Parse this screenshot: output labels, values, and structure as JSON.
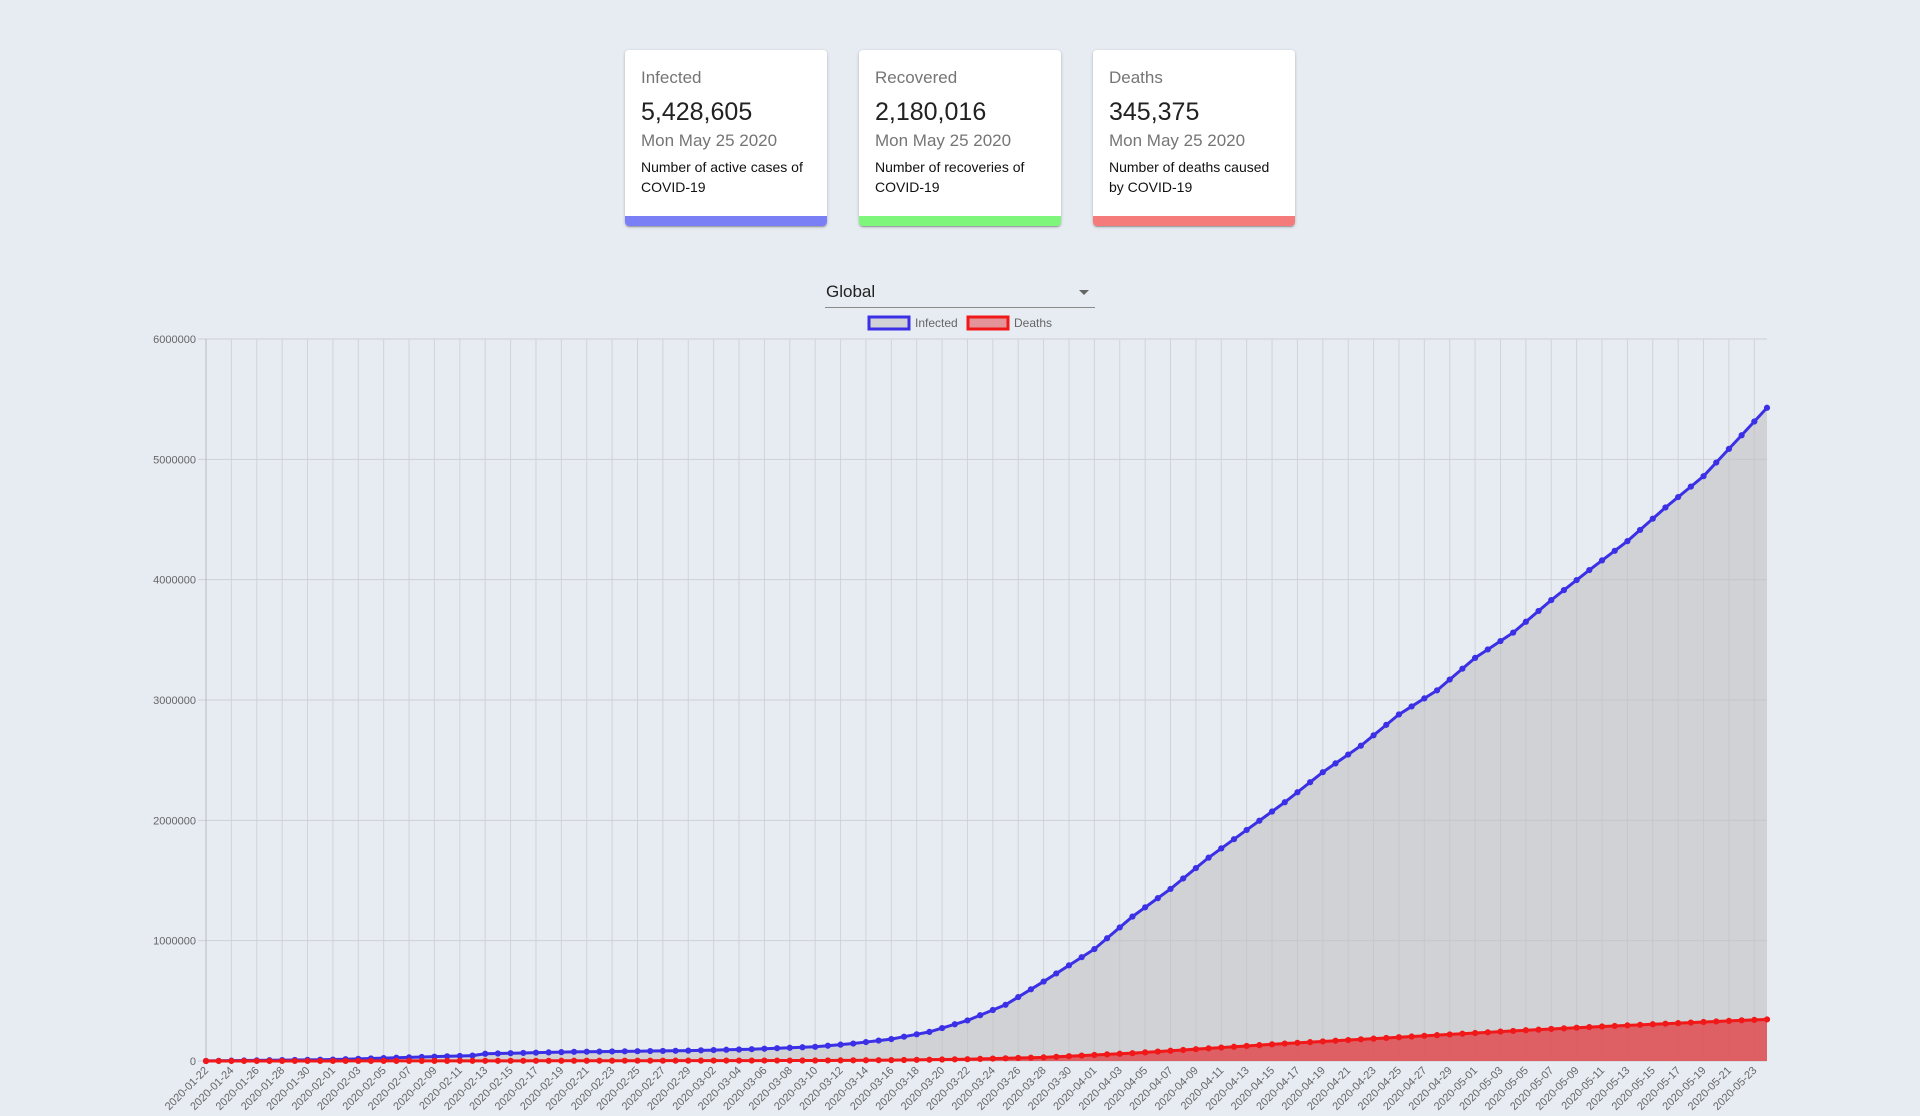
{
  "cards": [
    {
      "title": "Infected",
      "value": "5,428,605",
      "date": "Mon May 25 2020",
      "desc": "Number of active cases of COVID-19",
      "color": "#7b7ff5"
    },
    {
      "title": "Recovered",
      "value": "2,180,016",
      "date": "Mon May 25 2020",
      "desc": "Number of recoveries of COVID-19",
      "color": "#7ef57b"
    },
    {
      "title": "Deaths",
      "value": "345,375",
      "date": "Mon May 25 2020",
      "desc": "Number of deaths caused by COVID-19",
      "color": "#f57b7b"
    }
  ],
  "region_select": {
    "value": "Global"
  },
  "chart_data": {
    "type": "line",
    "x_start": "2020-01-22",
    "x_end": "2020-05-24",
    "x_tick_every": 2,
    "ylim": [
      0,
      6000000
    ],
    "yticks": [
      0,
      1000000,
      2000000,
      3000000,
      4000000,
      5000000,
      6000000
    ],
    "grid": true,
    "legend_position": "top",
    "series": [
      {
        "name": "Infected",
        "color": "#3b30e6",
        "fill": "rgba(190,190,190,0.55)",
        "anchors": [
          [
            "2020-01-22",
            555
          ],
          [
            "2020-02-01",
            12000
          ],
          [
            "2020-02-12",
            45000
          ],
          [
            "2020-02-13",
            60000
          ],
          [
            "2020-02-20",
            76000
          ],
          [
            "2020-02-29",
            86000
          ],
          [
            "2020-03-05",
            98000
          ],
          [
            "2020-03-10",
            118000
          ],
          [
            "2020-03-13",
            145000
          ],
          [
            "2020-03-16",
            182000
          ],
          [
            "2020-03-19",
            242000
          ],
          [
            "2020-03-22",
            337000
          ],
          [
            "2020-03-25",
            467000
          ],
          [
            "2020-03-28",
            660000
          ],
          [
            "2020-04-01",
            930000
          ],
          [
            "2020-04-04",
            1200000
          ],
          [
            "2020-04-07",
            1430000
          ],
          [
            "2020-04-10",
            1690000
          ],
          [
            "2020-04-13",
            1920000
          ],
          [
            "2020-04-16",
            2150000
          ],
          [
            "2020-04-19",
            2400000
          ],
          [
            "2020-04-22",
            2620000
          ],
          [
            "2020-04-25",
            2880000
          ],
          [
            "2020-04-28",
            3080000
          ],
          [
            "2020-05-01",
            3350000
          ],
          [
            "2020-05-04",
            3560000
          ],
          [
            "2020-05-07",
            3830000
          ],
          [
            "2020-05-10",
            4080000
          ],
          [
            "2020-05-13",
            4320000
          ],
          [
            "2020-05-16",
            4600000
          ],
          [
            "2020-05-19",
            4860000
          ],
          [
            "2020-05-22",
            5200000
          ],
          [
            "2020-05-24",
            5428605
          ]
        ]
      },
      {
        "name": "Deaths",
        "color": "#f01818",
        "fill": "rgba(225,75,80,0.85)",
        "anchors": [
          [
            "2020-01-22",
            17
          ],
          [
            "2020-02-12",
            1100
          ],
          [
            "2020-02-29",
            2900
          ],
          [
            "2020-03-10",
            4000
          ],
          [
            "2020-03-16",
            7000
          ],
          [
            "2020-03-22",
            15000
          ],
          [
            "2020-03-28",
            30000
          ],
          [
            "2020-04-04",
            65000
          ],
          [
            "2020-04-10",
            105000
          ],
          [
            "2020-04-16",
            145000
          ],
          [
            "2020-04-22",
            180000
          ],
          [
            "2020-04-28",
            215000
          ],
          [
            "2020-05-04",
            250000
          ],
          [
            "2020-05-10",
            282000
          ],
          [
            "2020-05-16",
            310000
          ],
          [
            "2020-05-22",
            338000
          ],
          [
            "2020-05-24",
            345375
          ]
        ]
      }
    ]
  }
}
